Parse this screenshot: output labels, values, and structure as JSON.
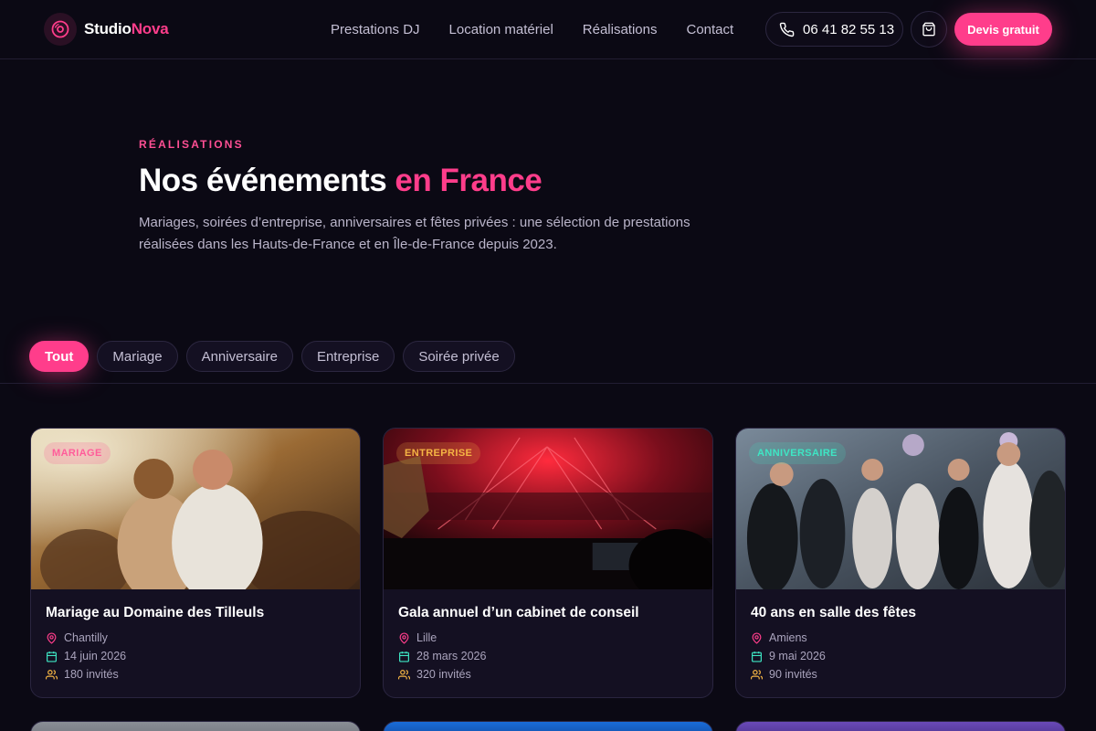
{
  "brand": {
    "name_part1": "Studio",
    "name_part2": "Nova",
    "accent": "#ff3d8b",
    "logo_icon": "vinyl-disc-icon"
  },
  "nav": {
    "items": [
      {
        "label": "Prestations DJ"
      },
      {
        "label": "Location matériel"
      },
      {
        "label": "Réalisations"
      },
      {
        "label": "Contact"
      }
    ]
  },
  "header": {
    "phone": "06 41 82 55 13",
    "phone_icon": "phone-icon",
    "cart_icon": "shopping-bag-icon",
    "cta_label": "Devis gratuit"
  },
  "hero": {
    "eyebrow": "RÉALISATIONS",
    "title_part1": "Nos événements",
    "title_part2": "en France",
    "description": "Mariages, soirées d’entreprise, anniversaires et fêtes privées : une sélection de prestations réalisées dans les Hauts-de-France et en Île-de-France depuis 2023."
  },
  "filters": {
    "items": [
      {
        "label": "Tout",
        "active": true
      },
      {
        "label": "Mariage",
        "active": false
      },
      {
        "label": "Anniversaire",
        "active": false
      },
      {
        "label": "Entreprise",
        "active": false
      },
      {
        "label": "Soirée privée",
        "active": false
      }
    ]
  },
  "cards": [
    {
      "category": "MARIAGE",
      "badge_color": "#ff5c9a",
      "title": "Mariage au Domaine des Tilleuls",
      "location": "Chantilly",
      "date": "14 juin 2026",
      "guests": "180 invités"
    },
    {
      "category": "ENTREPRISE",
      "badge_color": "#f5b544",
      "title": "Gala annuel d’un cabinet de conseil",
      "location": "Lille",
      "date": "28 mars 2026",
      "guests": "320 invités"
    },
    {
      "category": "ANNIVERSAIRE",
      "badge_color": "#3ee6c4",
      "title": "40 ans en salle des fêtes",
      "location": "Amiens",
      "date": "9 mai 2026",
      "guests": "90 invités"
    }
  ],
  "icons": {
    "location": "map-pin-icon",
    "date": "calendar-icon",
    "guests": "users-icon"
  }
}
